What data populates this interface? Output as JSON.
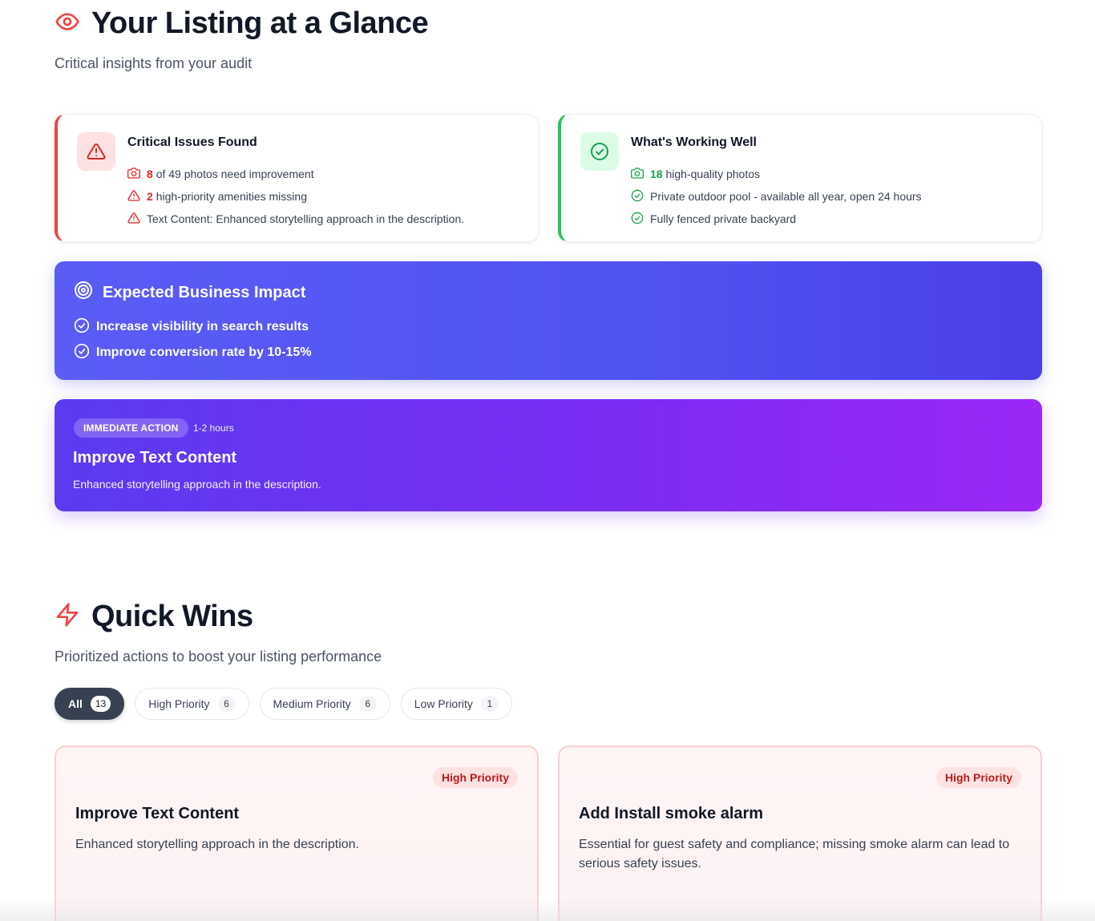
{
  "glance": {
    "title": "Your Listing at a Glance",
    "subtitle": "Critical insights from your audit"
  },
  "issues": {
    "title": "Critical Issues Found",
    "photos_num": "8",
    "photos_text": "of 49 photos need improvement",
    "amenities_num": "2",
    "amenities_text": "high-priority amenities missing",
    "text_content": "Text Content: Enhanced storytelling approach in the description."
  },
  "working": {
    "title": "What's Working Well",
    "photos_num": "18",
    "photos_text": "high-quality photos",
    "item1": "Private outdoor pool - available all year, open 24 hours",
    "item2": "Fully fenced private backyard"
  },
  "impact": {
    "title": "Expected Business Impact",
    "items": [
      "Increase visibility in search results",
      "Improve conversion rate by 10-15%"
    ]
  },
  "action": {
    "badge": "IMMEDIATE ACTION",
    "time": "1-2 hours",
    "title": "Improve Text Content",
    "description": "Enhanced storytelling approach in the description."
  },
  "quick_wins": {
    "title": "Quick Wins",
    "subtitle": "Prioritized actions to boost your listing performance",
    "filters": [
      {
        "label": "All",
        "count": "13"
      },
      {
        "label": "High Priority",
        "count": "6"
      },
      {
        "label": "Medium Priority",
        "count": "6"
      },
      {
        "label": "Low Priority",
        "count": "1"
      }
    ],
    "cards": [
      {
        "priority": "High Priority",
        "title": "Improve Text Content",
        "description": "Enhanced storytelling approach in the description."
      },
      {
        "priority": "High Priority",
        "title": "Add Install smoke alarm",
        "description": "Essential for guest safety and compliance; missing smoke alarm can lead to serious safety issues."
      }
    ]
  },
  "colors": {
    "critical": "#ef4444",
    "success": "#22c55e",
    "impact": "#5153f0",
    "action": "#7a2cf3",
    "active_filter": "#374151"
  },
  "icons": [
    "eye-icon",
    "alert-triangle-icon",
    "camera-icon",
    "check-circle-icon",
    "target-icon",
    "zap-icon"
  ]
}
